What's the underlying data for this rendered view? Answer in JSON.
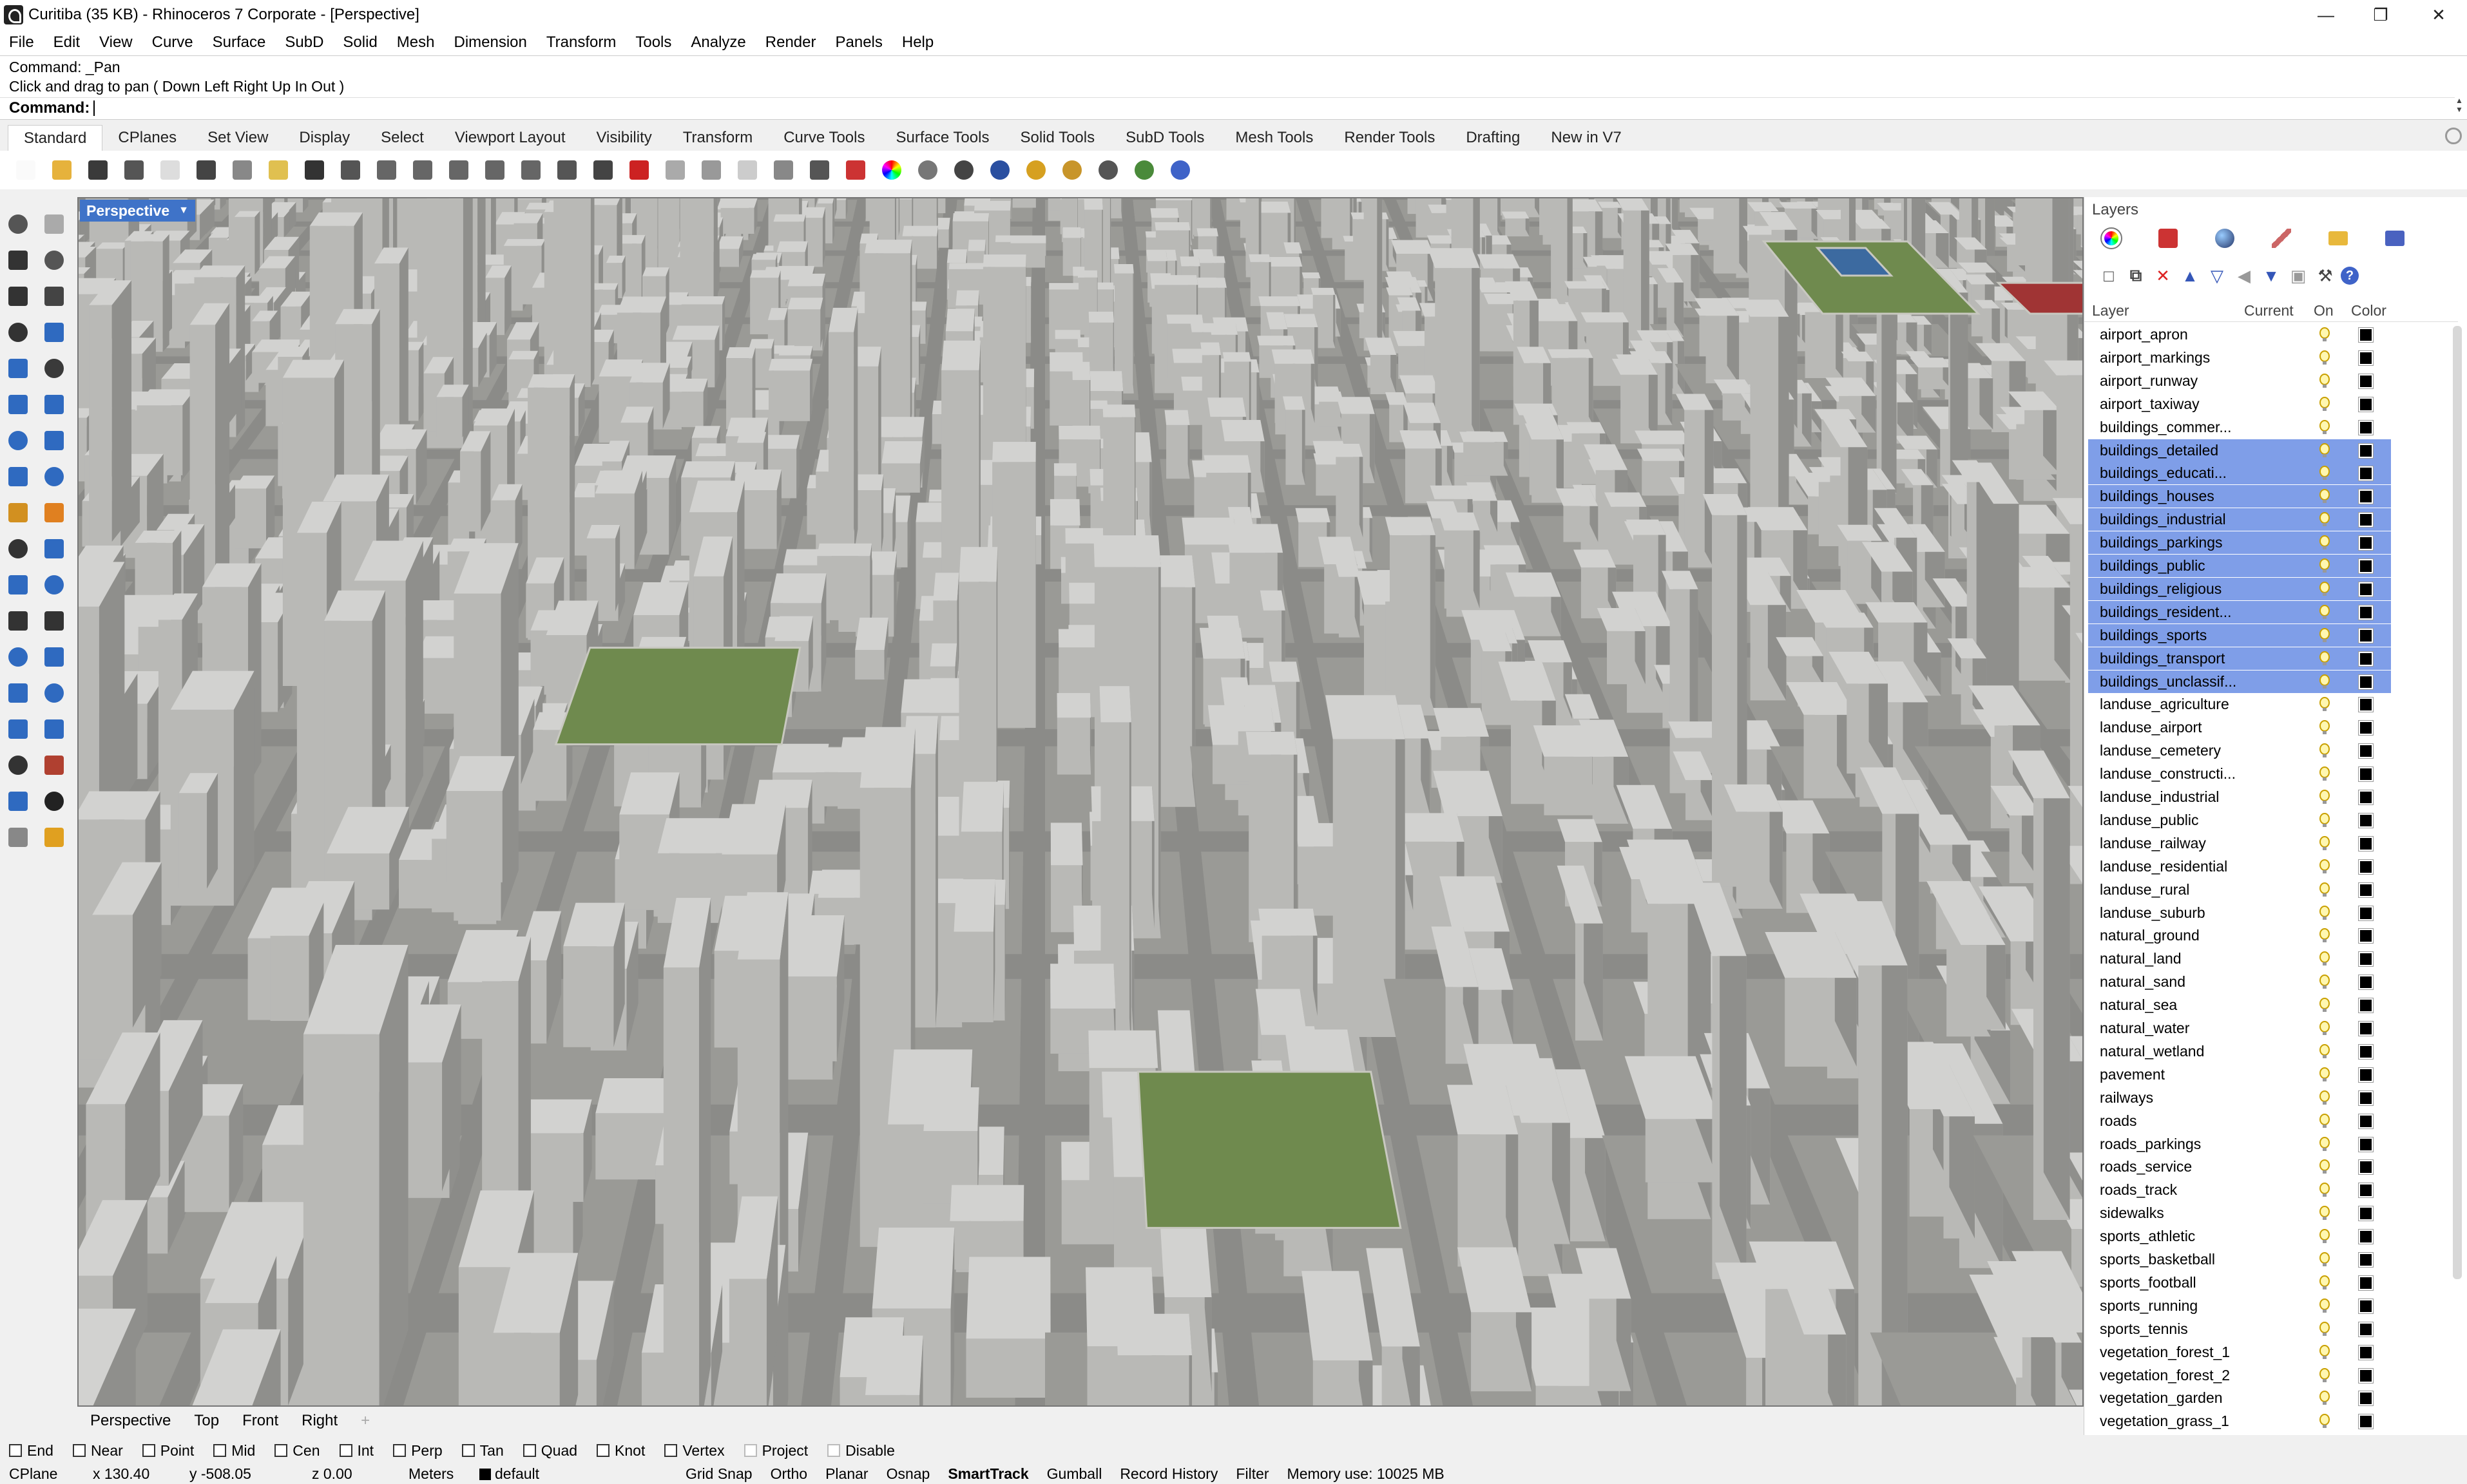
{
  "window": {
    "title": "Curitiba (35 KB) - Rhinoceros 7 Corporate - [Perspective]",
    "minimize_icon": "minimize-icon",
    "maximize_icon": "restore-icon",
    "close_icon": "close-icon"
  },
  "menu": [
    "File",
    "Edit",
    "View",
    "Curve",
    "Surface",
    "SubD",
    "Solid",
    "Mesh",
    "Dimension",
    "Transform",
    "Tools",
    "Analyze",
    "Render",
    "Panels",
    "Help"
  ],
  "command": {
    "history_line1": "Command: _Pan",
    "history_line2": "Click and drag to pan ( Down  Left  Right  Up  In  Out )",
    "prompt": "Command:"
  },
  "toolbar_tabs": [
    "Standard",
    "CPlanes",
    "Set View",
    "Display",
    "Select",
    "Viewport Layout",
    "Visibility",
    "Transform",
    "Curve Tools",
    "Surface Tools",
    "Solid Tools",
    "SubD Tools",
    "Mesh Tools",
    "Render Tools",
    "Drafting",
    "New in V7"
  ],
  "toolbar_icons": [
    "new-icon",
    "open-icon",
    "save-icon",
    "print-icon",
    "import-icon",
    "cut-icon",
    "copy-icon",
    "paste-icon",
    "undo-icon",
    "pan-icon",
    "rotate-icon",
    "zoom-icon",
    "zoom-window-icon",
    "zoom-extents-icon",
    "zoom-selected-icon",
    "rotate-view-icon",
    "four-viewports-icon",
    "car-icon",
    "cplane-icon",
    "dimension-icon",
    "points-icon",
    "light-icon",
    "lock-icon",
    "layer-icon",
    "color-wheel-icon",
    "material-icon",
    "render-icon",
    "sphere-icon",
    "hand-icon",
    "gear-settings-icon",
    "grid-icon",
    "globe-icon",
    "help-icon"
  ],
  "viewport": {
    "label": "Perspective",
    "tabs": [
      "Perspective",
      "Top",
      "Front",
      "Right"
    ]
  },
  "layers_panel": {
    "title": "Layers",
    "columns": {
      "layer": "Layer",
      "current": "Current",
      "on": "On",
      "color": "Color"
    },
    "layers": [
      {
        "name": "airport_apron",
        "selected": false
      },
      {
        "name": "airport_markings",
        "selected": false
      },
      {
        "name": "airport_runway",
        "selected": false
      },
      {
        "name": "airport_taxiway",
        "selected": false
      },
      {
        "name": "buildings_commer...",
        "selected": false
      },
      {
        "name": "buildings_detailed",
        "selected": true
      },
      {
        "name": "buildings_educati...",
        "selected": true
      },
      {
        "name": "buildings_houses",
        "selected": true
      },
      {
        "name": "buildings_industrial",
        "selected": true
      },
      {
        "name": "buildings_parkings",
        "selected": true
      },
      {
        "name": "buildings_public",
        "selected": true
      },
      {
        "name": "buildings_religious",
        "selected": true
      },
      {
        "name": "buildings_resident...",
        "selected": true
      },
      {
        "name": "buildings_sports",
        "selected": true
      },
      {
        "name": "buildings_transport",
        "selected": true
      },
      {
        "name": "buildings_unclassif...",
        "selected": true
      },
      {
        "name": "landuse_agriculture",
        "selected": false
      },
      {
        "name": "landuse_airport",
        "selected": false
      },
      {
        "name": "landuse_cemetery",
        "selected": false
      },
      {
        "name": "landuse_constructi...",
        "selected": false
      },
      {
        "name": "landuse_industrial",
        "selected": false
      },
      {
        "name": "landuse_public",
        "selected": false
      },
      {
        "name": "landuse_railway",
        "selected": false
      },
      {
        "name": "landuse_residential",
        "selected": false
      },
      {
        "name": "landuse_rural",
        "selected": false
      },
      {
        "name": "landuse_suburb",
        "selected": false
      },
      {
        "name": "natural_ground",
        "selected": false
      },
      {
        "name": "natural_land",
        "selected": false
      },
      {
        "name": "natural_sand",
        "selected": false
      },
      {
        "name": "natural_sea",
        "selected": false
      },
      {
        "name": "natural_water",
        "selected": false
      },
      {
        "name": "natural_wetland",
        "selected": false
      },
      {
        "name": "pavement",
        "selected": false
      },
      {
        "name": "railways",
        "selected": false
      },
      {
        "name": "roads",
        "selected": false
      },
      {
        "name": "roads_parkings",
        "selected": false
      },
      {
        "name": "roads_service",
        "selected": false
      },
      {
        "name": "roads_track",
        "selected": false
      },
      {
        "name": "sidewalks",
        "selected": false
      },
      {
        "name": "sports_athletic",
        "selected": false
      },
      {
        "name": "sports_basketball",
        "selected": false
      },
      {
        "name": "sports_football",
        "selected": false
      },
      {
        "name": "sports_running",
        "selected": false
      },
      {
        "name": "sports_tennis",
        "selected": false
      },
      {
        "name": "vegetation_forest_1",
        "selected": false
      },
      {
        "name": "vegetation_forest_2",
        "selected": false
      },
      {
        "name": "vegetation_garden",
        "selected": false
      },
      {
        "name": "vegetation_grass_1",
        "selected": false
      }
    ]
  },
  "osnaps": [
    {
      "label": "End",
      "checked": false
    },
    {
      "label": "Near",
      "checked": false
    },
    {
      "label": "Point",
      "checked": false
    },
    {
      "label": "Mid",
      "checked": false
    },
    {
      "label": "Cen",
      "checked": false
    },
    {
      "label": "Int",
      "checked": false
    },
    {
      "label": "Perp",
      "checked": false
    },
    {
      "label": "Tan",
      "checked": false
    },
    {
      "label": "Quad",
      "checked": false
    },
    {
      "label": "Knot",
      "checked": false
    },
    {
      "label": "Vertex",
      "checked": false
    },
    {
      "label": "Project",
      "checked": false,
      "dim": true
    },
    {
      "label": "Disable",
      "checked": false,
      "dim": true
    }
  ],
  "status": {
    "cplane": "CPlane",
    "x": "x 130.40",
    "y": "y -508.05",
    "z": "z 0.00",
    "units": "Meters",
    "layer": "default",
    "grid_snap": "Grid Snap",
    "ortho": "Ortho",
    "planar": "Planar",
    "osnap": "Osnap",
    "smarttrack": "SmartTrack",
    "gumball": "Gumball",
    "record_history": "Record History",
    "filter": "Filter",
    "memory": "Memory use: 10025 MB"
  },
  "colors": {
    "selection": "#7f9ee8",
    "viewport_label_bg": "#3f73c8",
    "ground": "#8b8b88",
    "building": "#d2d2d0",
    "park": "#6f8a4e",
    "water": "#3c6aa0",
    "track": "#a03434"
  }
}
